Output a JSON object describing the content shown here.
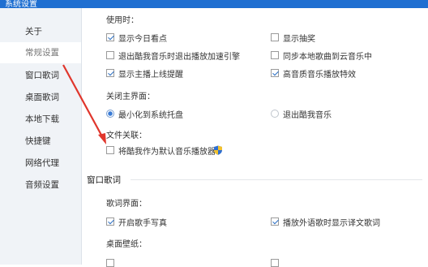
{
  "window": {
    "title": "系统设置"
  },
  "sidebar": {
    "items": [
      {
        "label": "关于"
      },
      {
        "label": "常规设置"
      },
      {
        "label": "窗口歌词"
      },
      {
        "label": "桌面歌词"
      },
      {
        "label": "本地下载"
      },
      {
        "label": "快捷键"
      },
      {
        "label": "网络代理"
      },
      {
        "label": "音频设置"
      }
    ]
  },
  "general": {
    "startup_label": "使用时：",
    "options": [
      {
        "label": "显示今日看点",
        "checked": true
      },
      {
        "label": "显示抽奖",
        "checked": false
      },
      {
        "label": "退出酷我音乐时退出播放加速引擎",
        "checked": false
      },
      {
        "label": "同步本地歌曲到云音乐中",
        "checked": false
      },
      {
        "label": "显示主播上线提醒",
        "checked": true
      },
      {
        "label": "高音质音乐播放特效",
        "checked": true
      }
    ],
    "close_label": "关闭主界面：",
    "close_options": [
      {
        "label": "最小化到系统托盘",
        "selected": true
      },
      {
        "label": "退出酷我音乐",
        "selected": false
      }
    ],
    "file_assoc_label": "文件关联：",
    "file_assoc_option": {
      "label": "将酷我作为默认音乐播放器",
      "checked": false
    }
  },
  "window_lyrics": {
    "title": "窗口歌词",
    "lyrics_ui_label": "歌词界面：",
    "options": [
      {
        "label": "开启歌手写真",
        "checked": true
      },
      {
        "label": "播放外语歌时显示译文歌词",
        "checked": true
      }
    ],
    "wallpaper_label": "桌面壁纸："
  }
}
